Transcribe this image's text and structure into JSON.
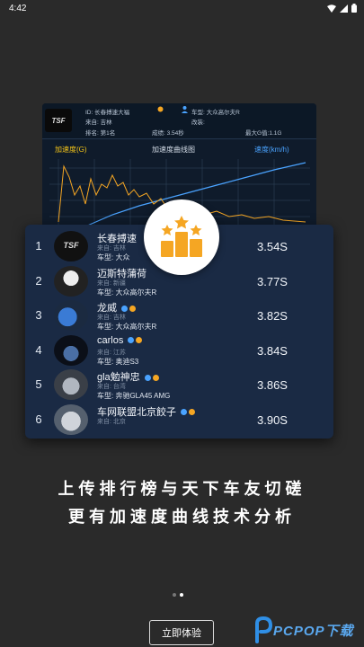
{
  "status": {
    "time": "4:42"
  },
  "profile": {
    "logo_text": "TSF",
    "id_label": "ID:",
    "id_value": "长春搏速大福",
    "car_label": "车型:",
    "car_value": "大众高尔夫R",
    "from_label": "来自:",
    "from_value": "吉林",
    "mod_label": "改装:",
    "rank_label": "排名:",
    "rank_value": "第1名",
    "score_label": "成绩:",
    "score_value": "3.54秒",
    "gforce_label": "最大G值:",
    "gforce_value": "1.1G"
  },
  "chart": {
    "left_label": "加速度(G)",
    "title": "加速度曲线图",
    "right_label": "速度(km/h)"
  },
  "ranking": [
    {
      "rank": "1",
      "name": "长春搏速",
      "from": "来自: 吉林",
      "car": "车型: 大众",
      "time": "3.54S",
      "avatar": "tsf"
    },
    {
      "rank": "2",
      "name": "迈斯特蒲荷",
      "from": "来自: 新疆",
      "car": "车型: 大众高尔夫R",
      "time": "3.77S",
      "avatar": "mst"
    },
    {
      "rank": "3",
      "name": "龙威",
      "from": "来自: 吉林",
      "car": "车型: 大众高尔夫R",
      "time": "3.82S",
      "avatar": "blue",
      "badges": true
    },
    {
      "rank": "4",
      "name": "carlos",
      "from": "来自: 江苏",
      "car": "车型: 奥迪S3",
      "time": "3.84S",
      "avatar": "dark",
      "badges": true
    },
    {
      "rank": "5",
      "name": "gla勉神忠",
      "from": "来自: 台湾",
      "car": "车型: 奔驰GLA45 AMG",
      "time": "3.86S",
      "avatar": "silver",
      "badges": true
    },
    {
      "rank": "6",
      "name": "车网联盟北京餃子",
      "from": "来自: 北京",
      "car": "",
      "time": "3.90S",
      "avatar": "grey",
      "badges": true
    }
  ],
  "headline": {
    "line1": "上传排行榜与天下车友切磋",
    "line2": "更有加速度曲线技术分析"
  },
  "pager": {
    "count": 2,
    "active": 1
  },
  "button": {
    "start_label": "立即体验"
  },
  "watermark": {
    "text": "PCPOP下载"
  },
  "colors": {
    "background": "#2a2a2a",
    "rank_card": "#1a2a44",
    "accent_orange": "#f5a623",
    "accent_blue": "#4aa3ff",
    "chart_yellow": "#f5c518"
  }
}
